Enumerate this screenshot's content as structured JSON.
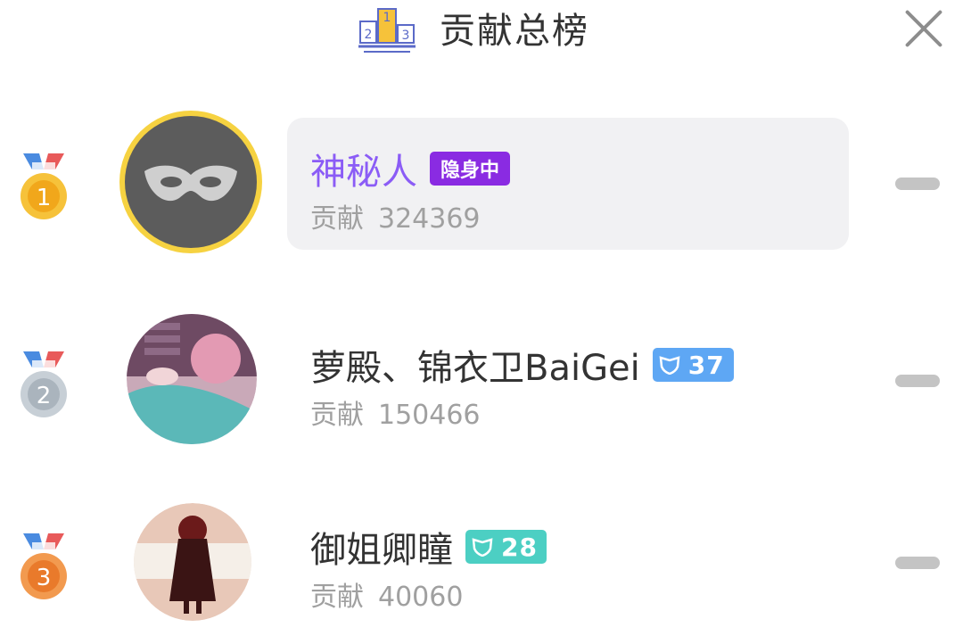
{
  "header": {
    "title": "贡献总榜",
    "podium_icon": "podium-icon",
    "podium_digits": [
      "2",
      "1",
      "3"
    ],
    "close_icon": "close-icon"
  },
  "colors": {
    "gold": "#f6c23a",
    "silver": "#b5bec6",
    "bronze": "#ee8a3a",
    "purple_name": "#8b5cf6",
    "hidden_badge": "#8a2be2",
    "level_blue": "#5ea7f4",
    "level_teal": "#4ccfc3"
  },
  "ranking": [
    {
      "rank": "1",
      "name": "神秘人",
      "badge": "隐身中",
      "contrib_label": "贡献",
      "contrib_value": "324369",
      "avatar_icon": "mask-icon"
    },
    {
      "rank": "2",
      "name": "萝殿、锦衣卫BaiGei",
      "level": "37",
      "contrib_label": "贡献",
      "contrib_value": "150466",
      "avatar_icon": "user-avatar"
    },
    {
      "rank": "3",
      "name": "御姐卿瞳",
      "level": "28",
      "contrib_label": "贡献",
      "contrib_value": "40060",
      "avatar_icon": "user-avatar"
    }
  ]
}
